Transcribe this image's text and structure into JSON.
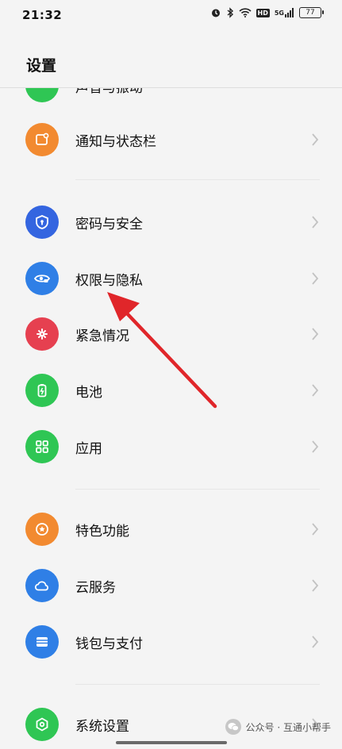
{
  "status_bar": {
    "time": "21:32",
    "battery": "77",
    "network": "5G"
  },
  "header": {
    "title": "设置"
  },
  "items": [
    {
      "label": "声音与振动",
      "color": "#2fc654",
      "icon": "sound-icon"
    },
    {
      "label": "通知与状态栏",
      "color": "#f28a30",
      "icon": "notification-icon"
    },
    {
      "label": "密码与安全",
      "color": "#3465e0",
      "icon": "shield-icon"
    },
    {
      "label": "权限与隐私",
      "color": "#2f7fe6",
      "icon": "privacy-eye-icon"
    },
    {
      "label": "紧急情况",
      "color": "#e64050",
      "icon": "emergency-icon"
    },
    {
      "label": "电池",
      "color": "#2fc654",
      "icon": "battery-icon"
    },
    {
      "label": "应用",
      "color": "#2fc654",
      "icon": "apps-grid-icon"
    },
    {
      "label": "特色功能",
      "color": "#f28a30",
      "icon": "star-badge-icon"
    },
    {
      "label": "云服务",
      "color": "#2f7fe6",
      "icon": "cloud-icon"
    },
    {
      "label": "钱包与支付",
      "color": "#2f7fe6",
      "icon": "wallet-icon"
    },
    {
      "label": "系统设置",
      "color": "#2fc654",
      "icon": "system-settings-icon"
    }
  ],
  "watermark": {
    "text": "公众号 · 互通小帮手"
  },
  "colors": {
    "arrow": "#e0262a",
    "background": "#f4f4f4"
  }
}
